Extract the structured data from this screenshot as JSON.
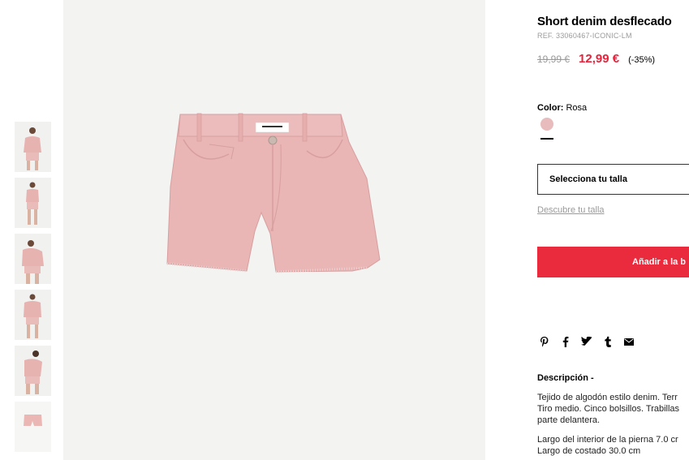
{
  "product": {
    "title": "Short denim desflecado",
    "ref": "REF. 33060467-ICONIC-LM",
    "old_price": "19,99 €",
    "new_price": "12,99 €",
    "discount": "(-35%)"
  },
  "color": {
    "label": "Color:",
    "value": "Rosa",
    "swatch_hex": "#e8bcbc"
  },
  "size": {
    "select_label": "Selecciona tu talla",
    "guide_link": "Descubre tu talla"
  },
  "cart": {
    "add_label": "Añadir a la b"
  },
  "social": [
    "pinterest-icon",
    "facebook-icon",
    "twitter-icon",
    "tumblr-icon",
    "email-icon"
  ],
  "description": {
    "title": "Descripción -",
    "line1": "Tejido de algodón estilo denim. Terr",
    "line2": "Tiro medio. Cinco bolsillos. Trabillas",
    "line3": "parte delantera.",
    "line4": "Largo del interior de la pierna 7.0 cr",
    "line5": "Largo de costado 30.0 cm"
  },
  "colors": {
    "accent": "#ea2a3d",
    "price": "#e5243b",
    "product": "#eab5b5"
  }
}
